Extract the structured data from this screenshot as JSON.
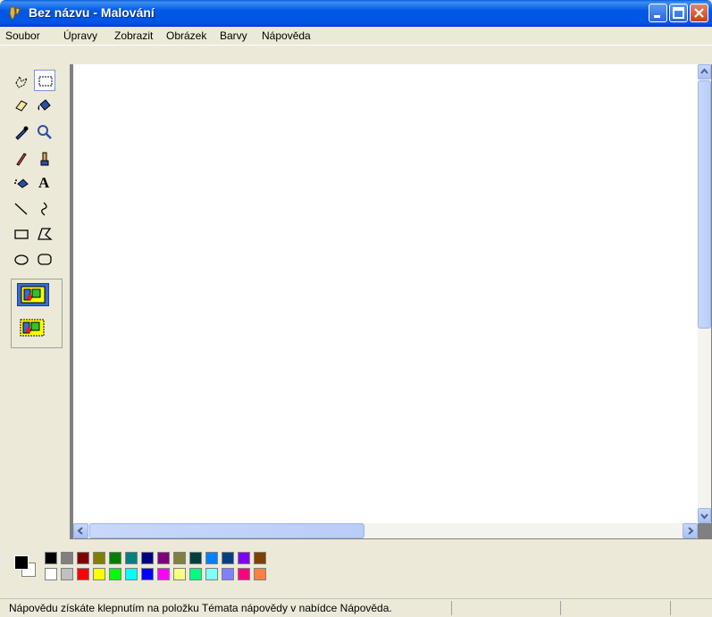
{
  "window": {
    "title": "Bez názvu - Malování",
    "app_icon": "paint-icon",
    "controls": [
      "minimize-icon",
      "maximize-icon",
      "close-icon"
    ],
    "titlebar_color": "#0054e3"
  },
  "menu": {
    "items": [
      "Soubor",
      "Úpravy",
      "Zobrazit",
      "Obrázek",
      "Barvy",
      "Nápověda"
    ]
  },
  "toolbox": {
    "tools": [
      {
        "name": "free-select",
        "icon": "free-select-icon",
        "active": false
      },
      {
        "name": "rect-select",
        "icon": "rect-select-icon",
        "active": true
      },
      {
        "name": "eraser",
        "icon": "eraser-icon",
        "active": false
      },
      {
        "name": "fill",
        "icon": "fill-bucket-icon",
        "active": false
      },
      {
        "name": "pick-color",
        "icon": "eyedropper-icon",
        "active": false
      },
      {
        "name": "magnifier",
        "icon": "magnifier-icon",
        "active": false
      },
      {
        "name": "pencil",
        "icon": "pencil-icon",
        "active": false
      },
      {
        "name": "brush",
        "icon": "brush-icon",
        "active": false
      },
      {
        "name": "airbrush",
        "icon": "airbrush-icon",
        "active": false
      },
      {
        "name": "text",
        "icon": "text-icon",
        "active": false,
        "glyph": "A"
      },
      {
        "name": "line",
        "icon": "line-icon",
        "active": false
      },
      {
        "name": "curve",
        "icon": "curve-icon",
        "active": false
      },
      {
        "name": "rectangle",
        "icon": "rectangle-icon",
        "active": false
      },
      {
        "name": "polygon",
        "icon": "polygon-icon",
        "active": false
      },
      {
        "name": "ellipse",
        "icon": "ellipse-icon",
        "active": false
      },
      {
        "name": "rounded-rectangle",
        "icon": "rounded-rectangle-icon",
        "active": false
      }
    ],
    "options": [
      {
        "name": "opaque-selection",
        "icon": "opaque-selection-icon",
        "active": true
      },
      {
        "name": "transparent-selection",
        "icon": "transparent-selection-icon",
        "active": false
      }
    ]
  },
  "palette": {
    "foreground": "#000000",
    "background": "#ffffff",
    "top_row": [
      "#000000",
      "#808080",
      "#800000",
      "#808000",
      "#008000",
      "#008080",
      "#000080",
      "#800080",
      "#808040",
      "#004040",
      "#0080ff",
      "#004080",
      "#8000ff",
      "#804000"
    ],
    "bottom_row": [
      "#ffffff",
      "#c0c0c0",
      "#ff0000",
      "#ffff00",
      "#00ff00",
      "#00ffff",
      "#0000ff",
      "#ff00ff",
      "#ffff80",
      "#00ff80",
      "#80ffff",
      "#8080ff",
      "#ff0080",
      "#ff8040"
    ]
  },
  "status": {
    "text": "Nápovědu získáte klepnutím na položku Témata nápovědy v nabídce Nápověda."
  }
}
